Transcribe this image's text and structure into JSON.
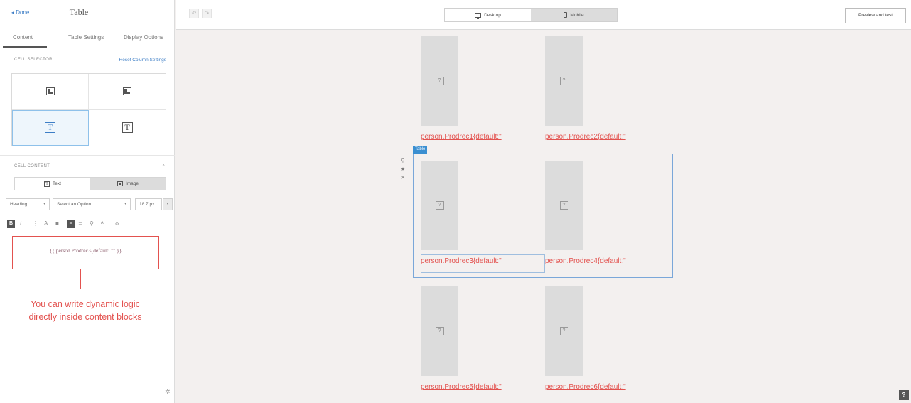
{
  "panel": {
    "back_label": "◂ Done",
    "title": "Table",
    "tabs": [
      "Content",
      "Table Settings",
      "Display Options"
    ],
    "cell_selector": {
      "label": "CELL SELECTOR",
      "link": "Reset Column Settings"
    },
    "cell_content": {
      "label": "CELL CONTENT",
      "toggle_text": "Text",
      "toggle_image": "Image",
      "dropdowns": [
        "Heading...",
        "Select an Option",
        "18.7 px"
      ],
      "logic": "{{ person.Prodrec3{default: \"\" }}"
    },
    "annotation_line1": "You can write dynamic logic",
    "annotation_line2": "directly inside content blocks"
  },
  "topbar": {
    "desktop_label": "Desktop",
    "mobile_label": "Mobile",
    "preview_label": "Preview and test"
  },
  "canvas": {
    "selection_tag": "Table",
    "products": [
      "person.Prodrec1{default:\"",
      "person.Prodrec2{default:\"",
      "person.Prodrec3{default:\"",
      "person.Prodrec4{default:\"",
      "person.Prodrec5{default:\"",
      "person.Prodrec6{default:\""
    ]
  },
  "help_label": "?"
}
